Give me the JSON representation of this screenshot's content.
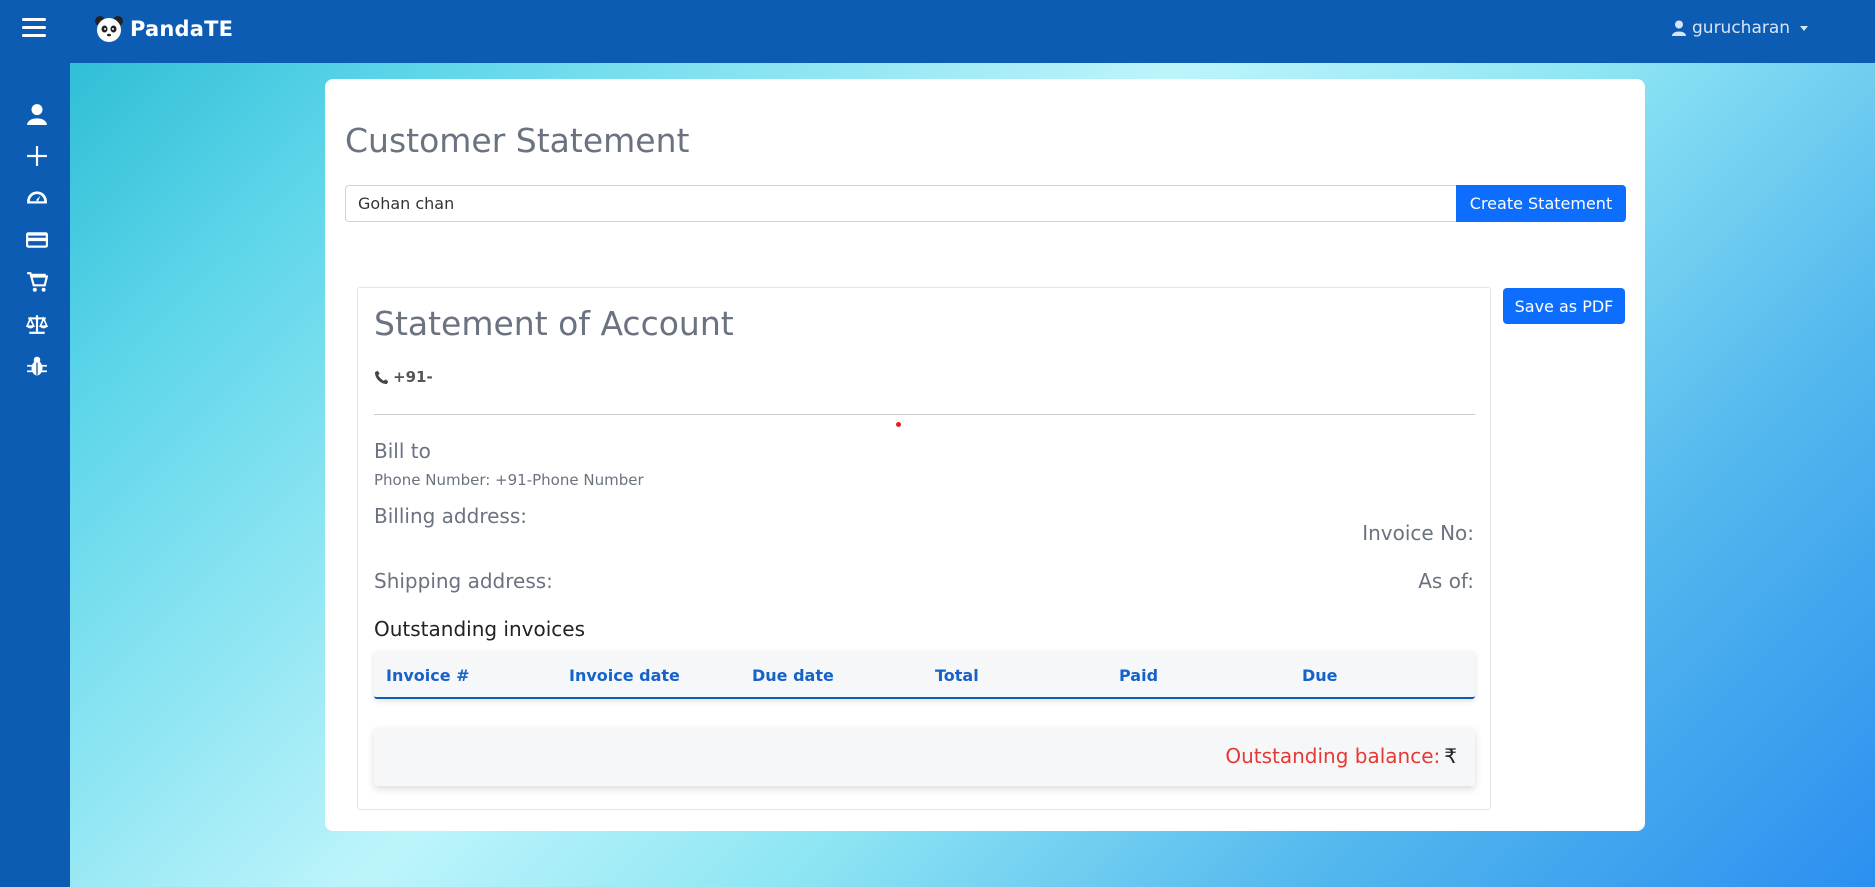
{
  "app": {
    "brand": "PandaTE"
  },
  "user": {
    "name": "gurucharan"
  },
  "sidebar": {
    "items": [
      {
        "icon": "user-icon"
      },
      {
        "icon": "plus-icon"
      },
      {
        "icon": "gauge-icon"
      },
      {
        "icon": "credit-card-icon"
      },
      {
        "icon": "cart-icon"
      },
      {
        "icon": "scale-icon"
      },
      {
        "icon": "bug-icon"
      }
    ]
  },
  "page": {
    "title": "Customer Statement",
    "customer_value": "Gohan chan",
    "create_label": "Create Statement",
    "pdf_label": "Save as PDF"
  },
  "statement": {
    "title": "Statement of Account",
    "phone": "+91-",
    "bill_to": "Bill to",
    "phone_number": "Phone Number: +91-Phone Number",
    "billing_address": "Billing address:",
    "invoice_no": "Invoice No:",
    "shipping_address": "Shipping address:",
    "as_of": "As of:",
    "outstanding_title": "Outstanding invoices",
    "columns": [
      "Invoice #",
      "Invoice date",
      "Due date",
      "Total",
      "Paid",
      "Due"
    ],
    "balance_label": "Outstanding balance:",
    "currency": "₹"
  },
  "colors": {
    "topbar": "#0c5cb3",
    "primary": "#0d6efd",
    "balance": "#e53935"
  }
}
